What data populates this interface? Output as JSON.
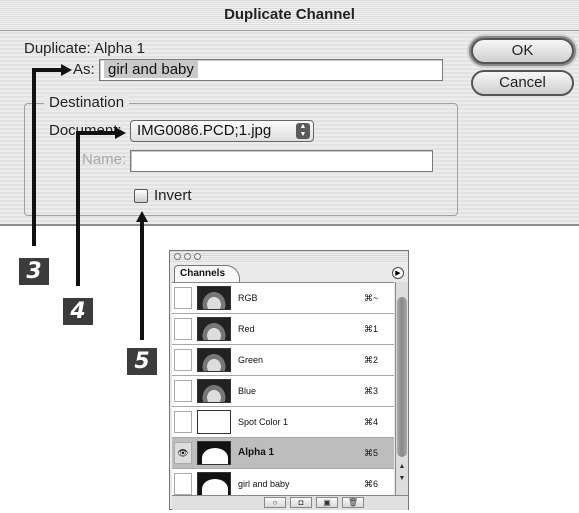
{
  "dialog": {
    "title": "Duplicate Channel",
    "duplicate_label": "Duplicate: Alpha 1",
    "as_label": "As:",
    "as_value": "girl and baby",
    "ok_label": "OK",
    "cancel_label": "Cancel",
    "destination_label": "Destination",
    "document_label": "Document:",
    "document_value": "IMG0086.PCD;1.jpg",
    "name_label": "Name:",
    "name_value": "",
    "invert_label": "Invert"
  },
  "callouts": [
    "3",
    "4",
    "5"
  ],
  "channels_panel": {
    "tab_label": "Channels",
    "rows": [
      {
        "name": "RGB",
        "shortcut": "⌘~",
        "thumb": "color",
        "selected": false,
        "visible": false
      },
      {
        "name": "Red",
        "shortcut": "⌘1",
        "thumb": "color",
        "selected": false,
        "visible": false
      },
      {
        "name": "Green",
        "shortcut": "⌘2",
        "thumb": "color",
        "selected": false,
        "visible": false
      },
      {
        "name": "Blue",
        "shortcut": "⌘3",
        "thumb": "color",
        "selected": false,
        "visible": false
      },
      {
        "name": "Spot Color 1",
        "shortcut": "⌘4",
        "thumb": "white",
        "selected": false,
        "visible": false
      },
      {
        "name": "Alpha 1",
        "shortcut": "⌘5",
        "thumb": "mask",
        "selected": true,
        "visible": true
      },
      {
        "name": "girl and baby",
        "shortcut": "⌘6",
        "thumb": "mask",
        "selected": false,
        "visible": false
      }
    ]
  },
  "icons": {
    "popup": "up-down-arrows-icon",
    "panel_menu": "panel-menu-arrow-icon",
    "eye": "eye-icon"
  }
}
